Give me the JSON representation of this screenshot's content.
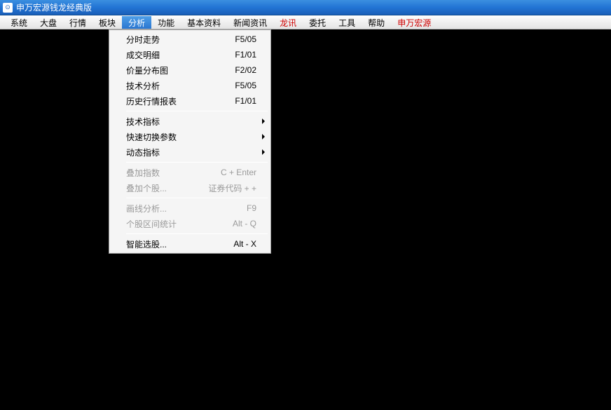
{
  "titlebar": {
    "title": "申万宏源钱龙经典版"
  },
  "menubar": {
    "items": [
      {
        "label": "系统",
        "red": false,
        "active": false
      },
      {
        "label": "大盘",
        "red": false,
        "active": false
      },
      {
        "label": "行情",
        "red": false,
        "active": false
      },
      {
        "label": "板块",
        "red": false,
        "active": false
      },
      {
        "label": "分析",
        "red": false,
        "active": true
      },
      {
        "label": "功能",
        "red": false,
        "active": false
      },
      {
        "label": "基本资料",
        "red": false,
        "active": false
      },
      {
        "label": "新闻资讯",
        "red": false,
        "active": false
      },
      {
        "label": "龙讯",
        "red": true,
        "active": false
      },
      {
        "label": "委托",
        "red": false,
        "active": false
      },
      {
        "label": "工具",
        "red": false,
        "active": false
      },
      {
        "label": "帮助",
        "red": false,
        "active": false
      },
      {
        "label": "申万宏源",
        "red": true,
        "active": false
      }
    ]
  },
  "dropdown": {
    "groups": [
      [
        {
          "label": "分时走势",
          "shortcut": "F5/05",
          "submenu": false,
          "disabled": false
        },
        {
          "label": "成交明细",
          "shortcut": "F1/01",
          "submenu": false,
          "disabled": false
        },
        {
          "label": "价量分布图",
          "shortcut": "F2/02",
          "submenu": false,
          "disabled": false
        },
        {
          "label": "技术分析",
          "shortcut": "F5/05",
          "submenu": false,
          "disabled": false
        },
        {
          "label": "历史行情报表",
          "shortcut": "F1/01",
          "submenu": false,
          "disabled": false
        }
      ],
      [
        {
          "label": "技术指标",
          "shortcut": "",
          "submenu": true,
          "disabled": false
        },
        {
          "label": "快速切换参数",
          "shortcut": "",
          "submenu": true,
          "disabled": false
        },
        {
          "label": "动态指标",
          "shortcut": "",
          "submenu": true,
          "disabled": false
        }
      ],
      [
        {
          "label": "叠加指数",
          "shortcut": "C + Enter",
          "submenu": false,
          "disabled": true
        },
        {
          "label": "叠加个股...",
          "shortcut": "证券代码 + +",
          "submenu": false,
          "disabled": true
        }
      ],
      [
        {
          "label": "画线分析...",
          "shortcut": "F9",
          "submenu": false,
          "disabled": true
        },
        {
          "label": "个股区间统计",
          "shortcut": "Alt - Q",
          "submenu": false,
          "disabled": true
        }
      ],
      [
        {
          "label": "智能选股...",
          "shortcut": "Alt - X",
          "submenu": false,
          "disabled": false
        }
      ]
    ]
  }
}
